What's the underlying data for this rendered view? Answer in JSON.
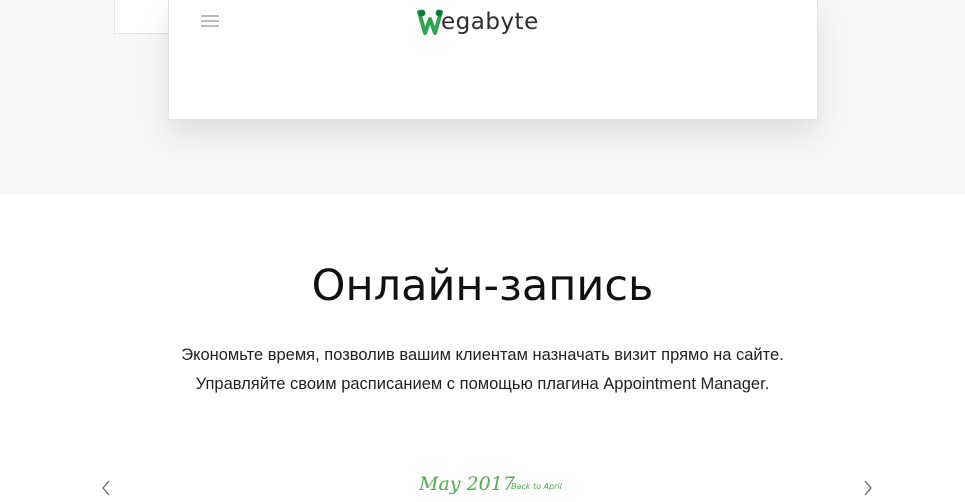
{
  "header": {
    "logo_text": "egabyte",
    "logo_full": "Wegabyte",
    "brand_color": "#2ea44f"
  },
  "section": {
    "title": "Онлайн-запись",
    "description_line1": "Экономьте время, позволив вашим клиентам назначать визит прямо на сайте.",
    "description_line2": "Управляйте своим расписанием с помощью плагина Appointment Manager."
  },
  "calendar": {
    "month_label": "May 2017",
    "back_link": "Back to April",
    "accent_color": "#4cae4c",
    "prev_icon": "chevron-left-icon",
    "next_icon": "chevron-right-icon"
  },
  "icons": {
    "menu": "hamburger-menu-icon"
  },
  "colors": {
    "hero_background": "#f8f7f7",
    "text": "#111111"
  }
}
